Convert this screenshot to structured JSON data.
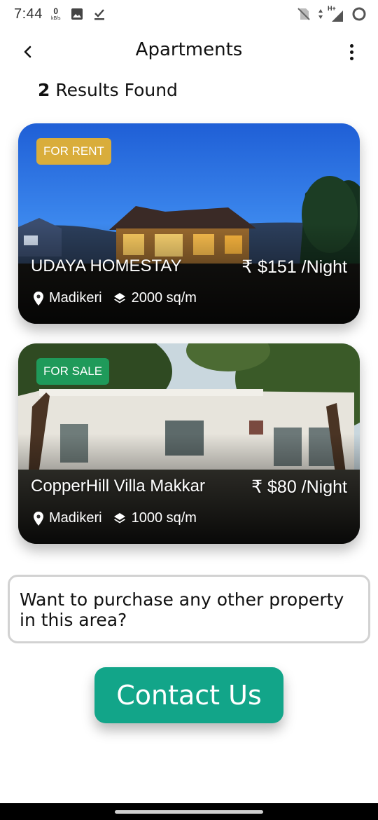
{
  "status_bar": {
    "time": "7:44",
    "net_speed_value": "0",
    "net_speed_unit": "kB/s",
    "network_label": "H+",
    "icons": [
      "image-icon",
      "download-done-icon",
      "no-sim-icon",
      "data-arrows-icon",
      "signal-icon",
      "loading-circle-icon"
    ]
  },
  "app_bar": {
    "title": "Apartments",
    "back_icon": "back-arrow-icon",
    "menu_icon": "more-vertical-icon"
  },
  "results": {
    "count": "2",
    "label": "Results Found"
  },
  "listings": [
    {
      "badge": "FOR RENT",
      "badge_color": "#d9ad3b",
      "name": "UDAYA HOMESTAY",
      "price": "₹ $151 /Night",
      "location": "Madikeri",
      "area": "2000 sq/m"
    },
    {
      "badge": "FOR SALE",
      "badge_color": "#1f9a5a",
      "name": "CopperHill Villa Makkar",
      "price": "₹ $80 /Night",
      "location": "Madikeri",
      "area": "1000 sq/m"
    }
  ],
  "inquiry": {
    "text": "Want to purchase any other property in this area?"
  },
  "contact_button": {
    "label": "Contact Us",
    "color": "#12a589"
  }
}
